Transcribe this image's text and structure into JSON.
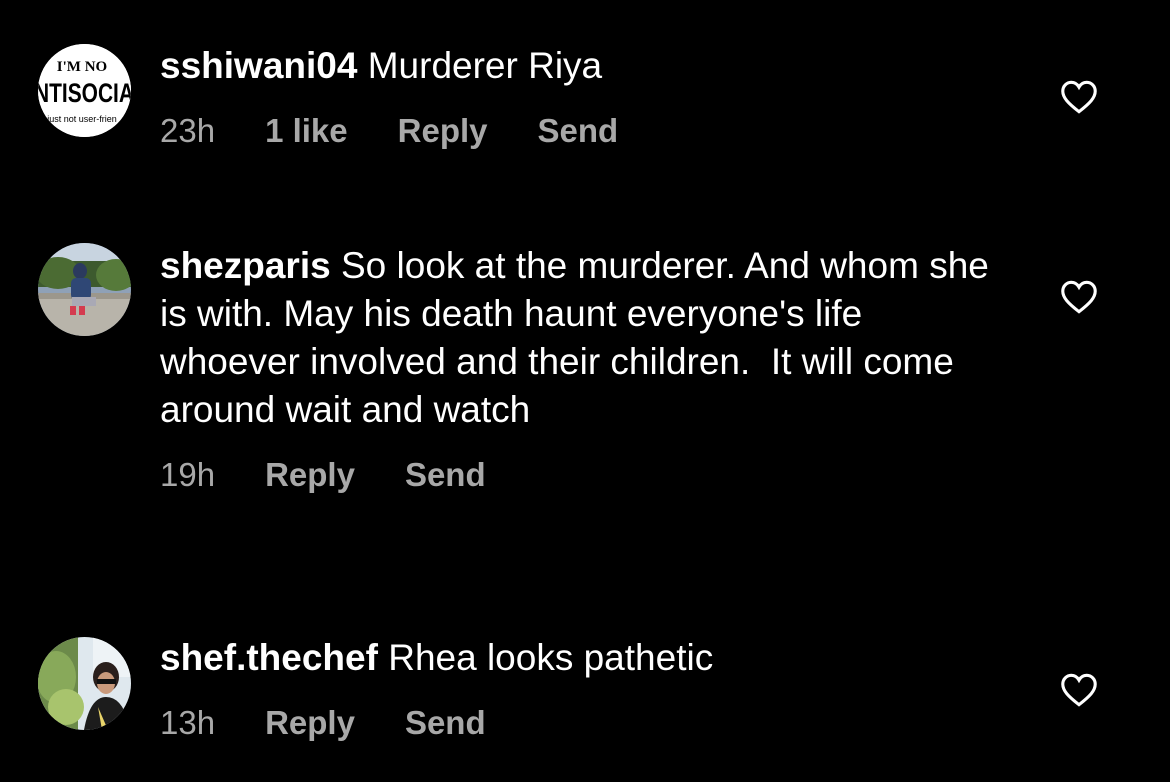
{
  "comments": [
    {
      "username": "sshiwani04",
      "text": "Murderer Riya",
      "time": "23h",
      "likes": "1 like",
      "reply_label": "Reply",
      "send_label": "Send",
      "avatar": {
        "line1": "I'M NO",
        "line2": "NTISOCIA",
        "line3": "just not user-frien"
      }
    },
    {
      "username": "shezparis",
      "text": "So look at the murderer. And whom she is with. May his death haunt everyone's life whoever involved and their children.  It will come around wait and watch",
      "time": "19h",
      "reply_label": "Reply",
      "send_label": "Send"
    },
    {
      "username": "shef.thechef",
      "text": "Rhea looks pathetic",
      "time": "13h",
      "reply_label": "Reply",
      "send_label": "Send"
    }
  ],
  "colors": {
    "background": "#000000",
    "text": "#ffffff",
    "meta": "#a8a8a8"
  },
  "icons": {
    "like": "heart-outline-icon"
  }
}
